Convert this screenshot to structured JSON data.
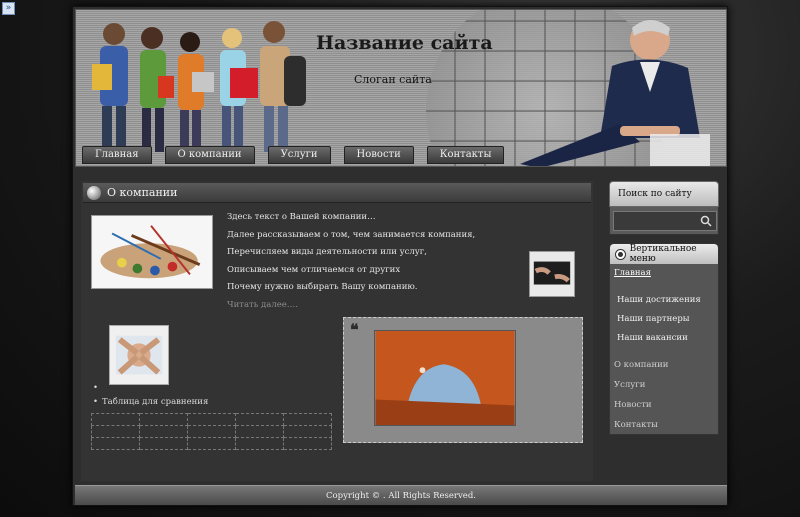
{
  "header": {
    "site_title": "Название сайта",
    "slogan": "Слоган сайта"
  },
  "nav": [
    {
      "label": "Главная"
    },
    {
      "label": "О компании"
    },
    {
      "label": "Услуги"
    },
    {
      "label": "Новости"
    },
    {
      "label": "Контакты"
    }
  ],
  "main": {
    "section_title": "О компании",
    "lines": [
      "Здесь текст о Вашей компании…",
      "Далее рассказываем о том, чем занимается компания,",
      "Перечисляем виды деятельности или услуг,",
      "Описываем чем отличаемся от других",
      "Почему нужно выбирать Вашу компанию."
    ],
    "read_more": "Читать далее….",
    "list": [
      "",
      "Таблица для сравнения"
    ],
    "quote_mark": "❝"
  },
  "sidebar": {
    "search_title": "Поиск по сайту",
    "search_value": "",
    "menu_title": "Вертикальное меню",
    "menu_top": "Главная",
    "menu_sub": [
      "Наши достижения",
      "Наши партнеры",
      "Наши вакансии"
    ],
    "menu_plain": [
      "О компании",
      "Услуги",
      "Новости",
      "Контакты"
    ]
  },
  "footer": {
    "copyright": "Copyright © .    All Rights Reserved."
  },
  "colors": {
    "page_bg": "#2e2e2e",
    "header_bg": "#a6a6a6",
    "accent_text": "#eeeeee"
  },
  "icons": [
    "expand-icon",
    "search-icon",
    "orb-icon",
    "menu-bullet-icon",
    "quote-icon"
  ]
}
